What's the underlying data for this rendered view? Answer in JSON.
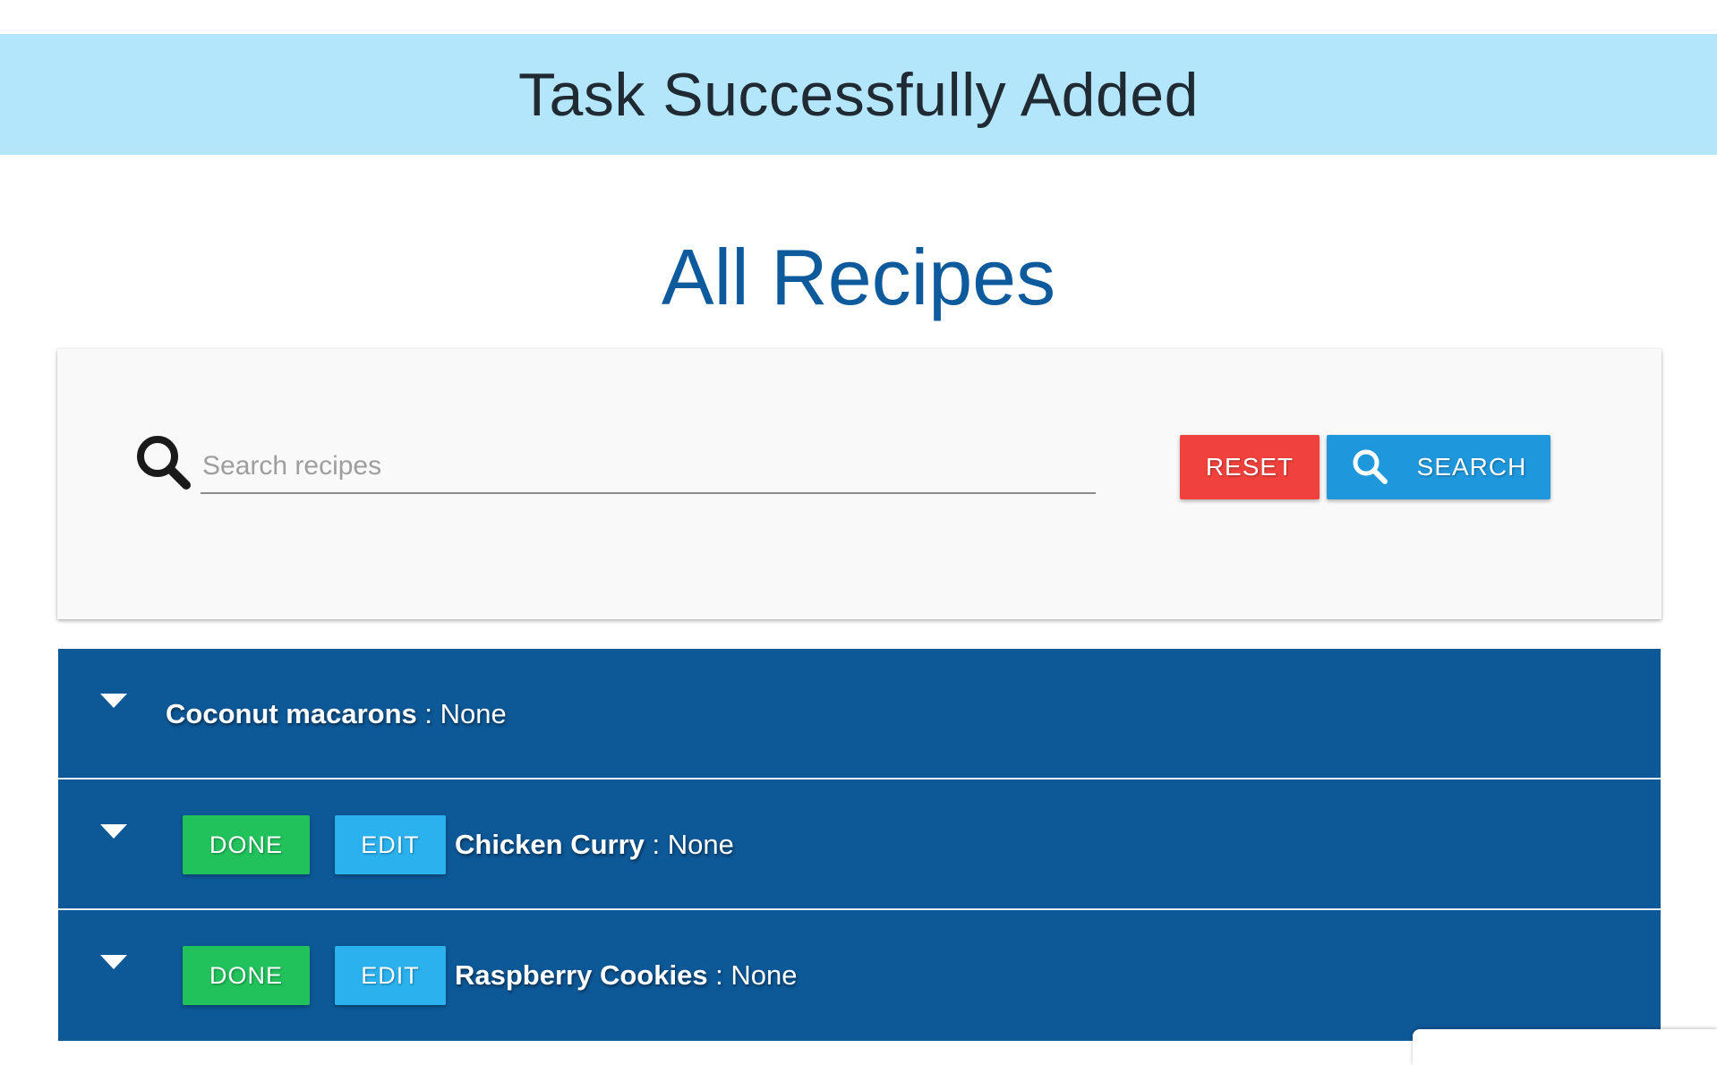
{
  "alert": {
    "message": "Task Successfully Added"
  },
  "page": {
    "title": "All Recipes"
  },
  "search": {
    "placeholder": "Search recipes",
    "value": "",
    "reset_label": "RESET",
    "search_label": "SEARCH"
  },
  "recipes": [
    {
      "name": "Coconut macarons",
      "separator": " : ",
      "status": "None",
      "has_actions": false
    },
    {
      "name": "Chicken Curry",
      "separator": " : ",
      "status": "None",
      "has_actions": true,
      "done_label": "DONE",
      "edit_label": "EDIT"
    },
    {
      "name": "Raspberry Cookies",
      "separator": " : ",
      "status": "None",
      "has_actions": true,
      "done_label": "DONE",
      "edit_label": "EDIT"
    }
  ],
  "colors": {
    "alert_bg": "#b3e5fb",
    "title": "#0d5a9c",
    "row_bg": "#0d5897",
    "reset": "#f0413c",
    "search": "#1f97dc",
    "done": "#21c15b",
    "edit": "#2ab1ee"
  },
  "icons": {
    "search": "search-icon",
    "caret": "caret-down-icon"
  }
}
